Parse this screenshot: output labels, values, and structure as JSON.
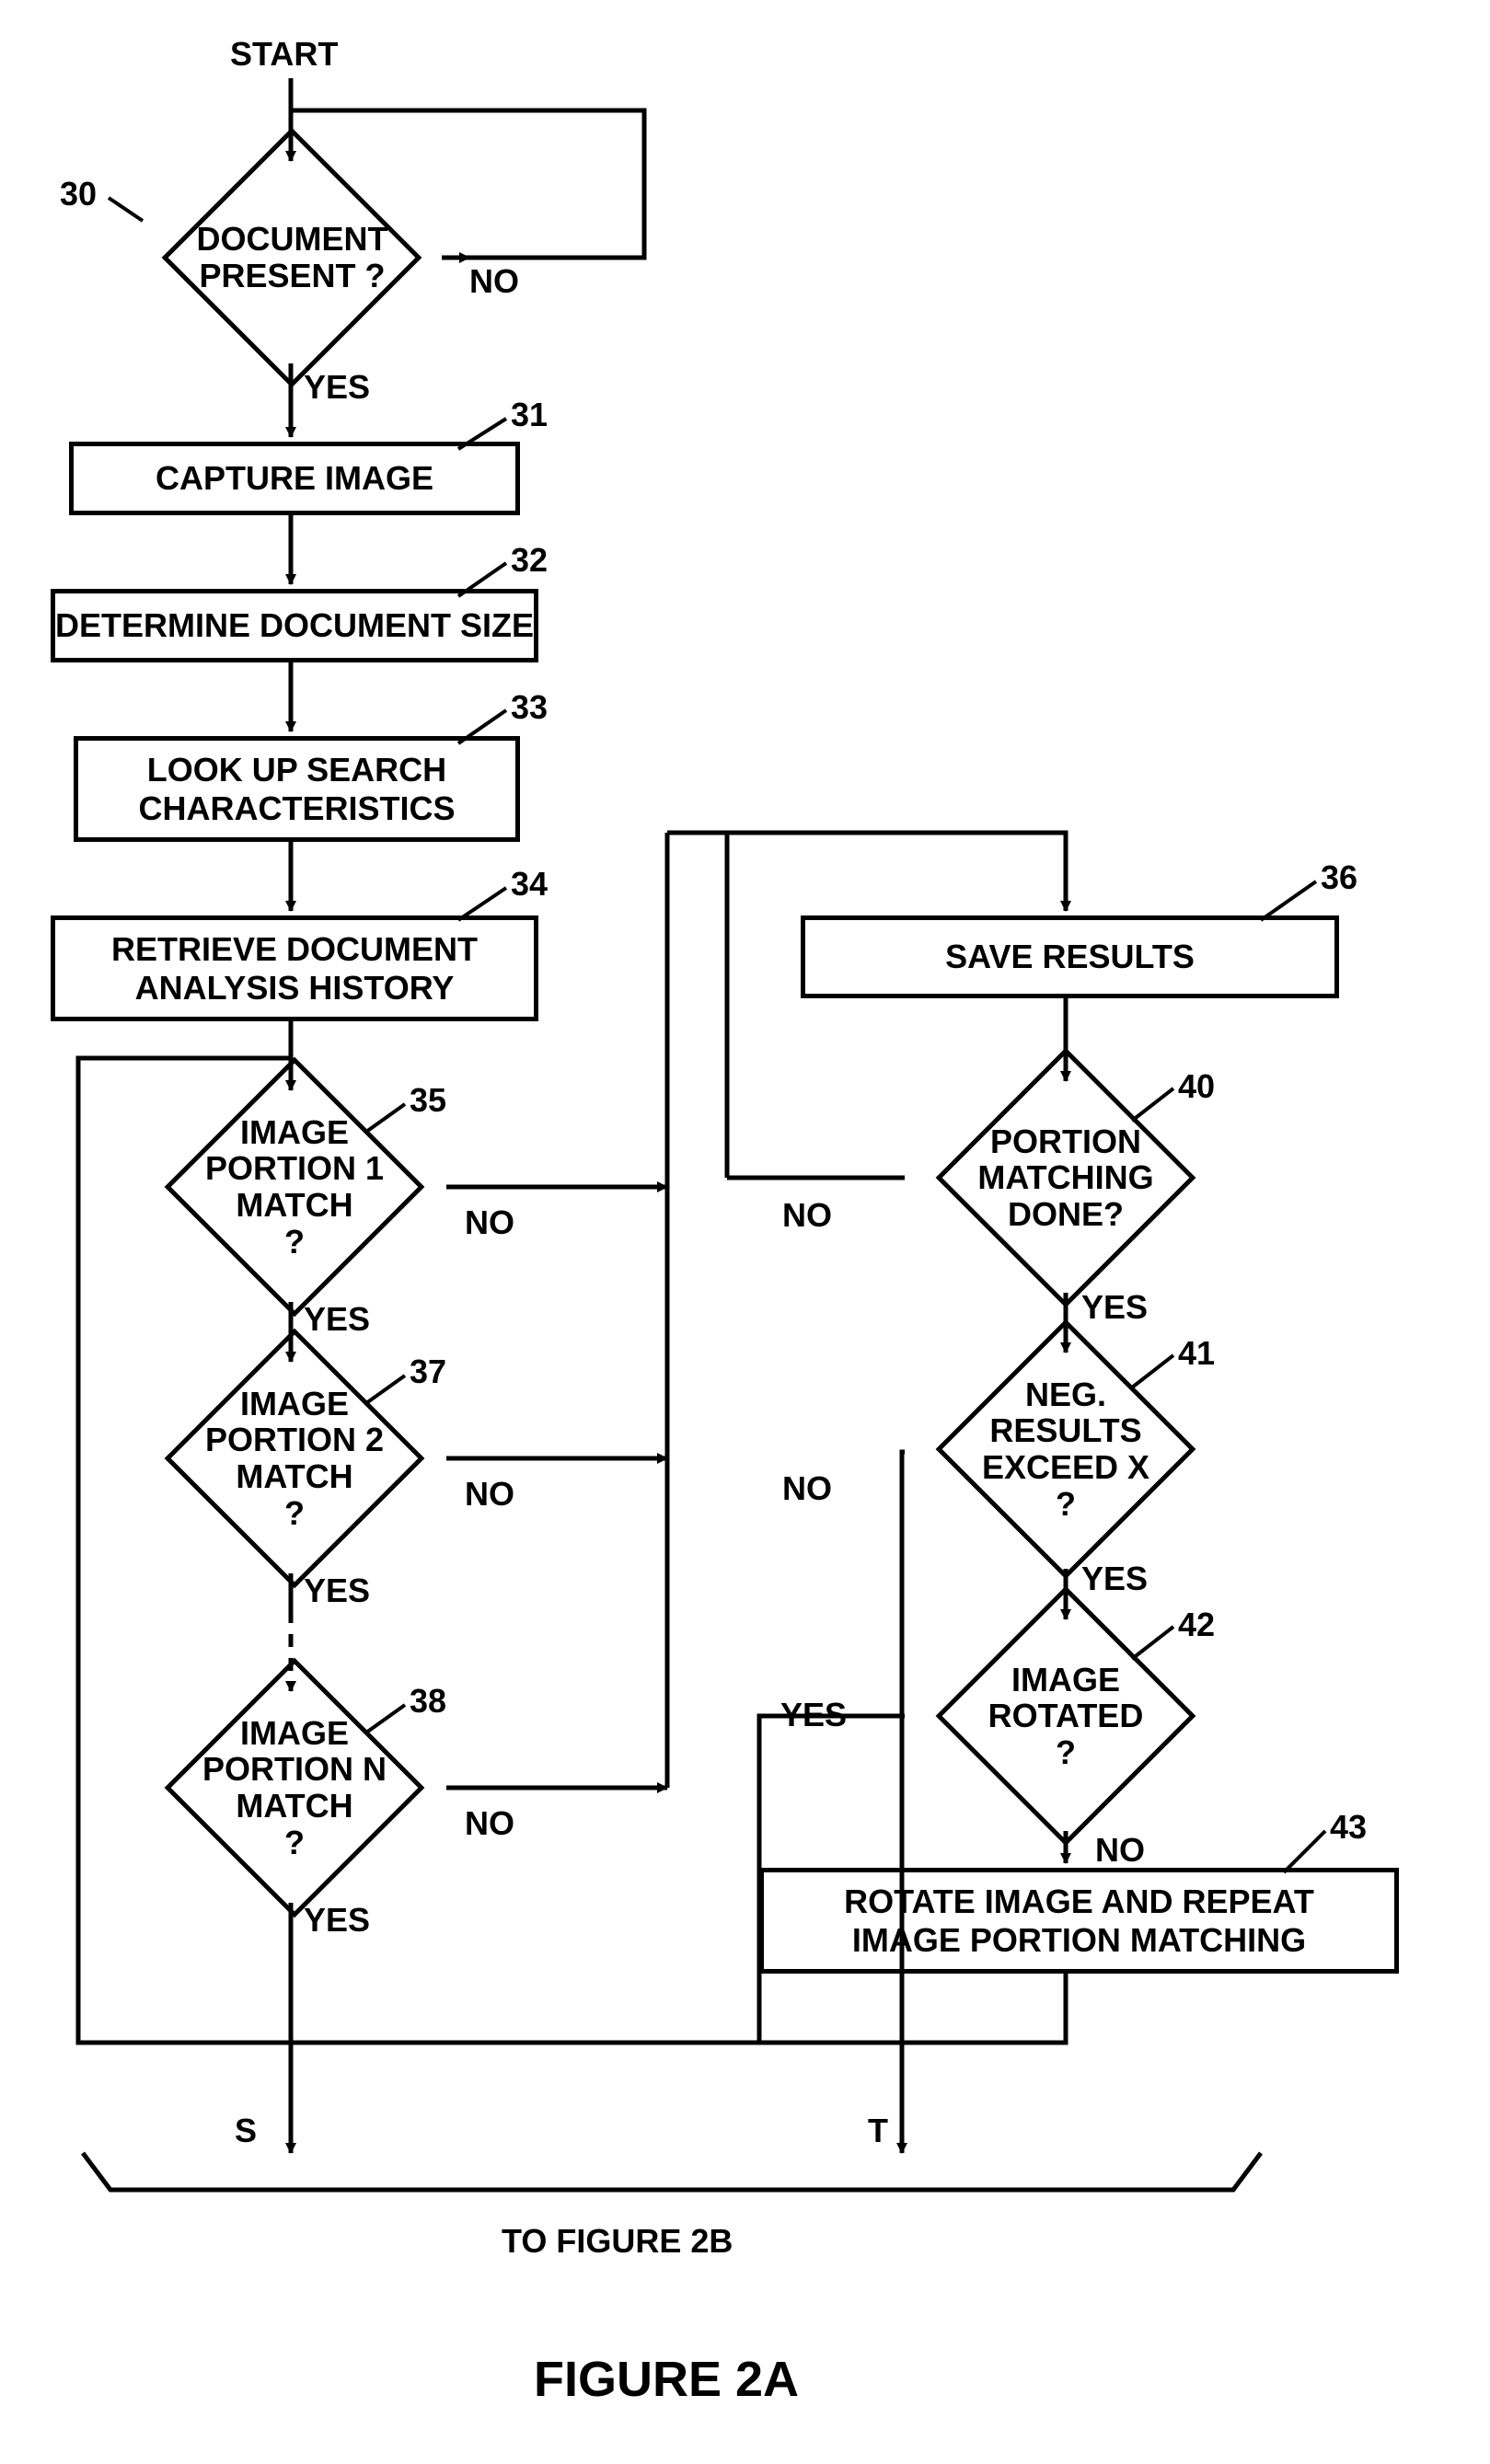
{
  "labels": {
    "start": "START",
    "no": "NO",
    "yes": "YES",
    "s": "S",
    "t": "T",
    "tofig": "TO FIGURE 2B",
    "figtitle": "FIGURE  2A"
  },
  "refs": {
    "r30": "30",
    "r31": "31",
    "r32": "32",
    "r33": "33",
    "r34": "34",
    "r35": "35",
    "r36": "36",
    "r37": "37",
    "r38": "38",
    "r40": "40",
    "r41": "41",
    "r42": "42",
    "r43": "43"
  },
  "nodes": {
    "n30": "DOCUMENT\nPRESENT ?",
    "n31": "CAPTURE IMAGE",
    "n32": "DETERMINE DOCUMENT SIZE",
    "n33": "LOOK UP SEARCH\nCHARACTERISTICS",
    "n34": "RETRIEVE DOCUMENT\nANALYSIS HISTORY",
    "n35": "IMAGE\nPORTION 1\nMATCH\n?",
    "n36": "SAVE RESULTS",
    "n37": "IMAGE\nPORTION 2\nMATCH\n?",
    "n38": "IMAGE\nPORTION N\nMATCH\n?",
    "n40": "PORTION\nMATCHING\nDONE?",
    "n41": "NEG.\nRESULTS\nEXCEED X\n?",
    "n42": "IMAGE\nROTATED\n?",
    "n43": "ROTATE IMAGE AND REPEAT\nIMAGE PORTION MATCHING"
  }
}
